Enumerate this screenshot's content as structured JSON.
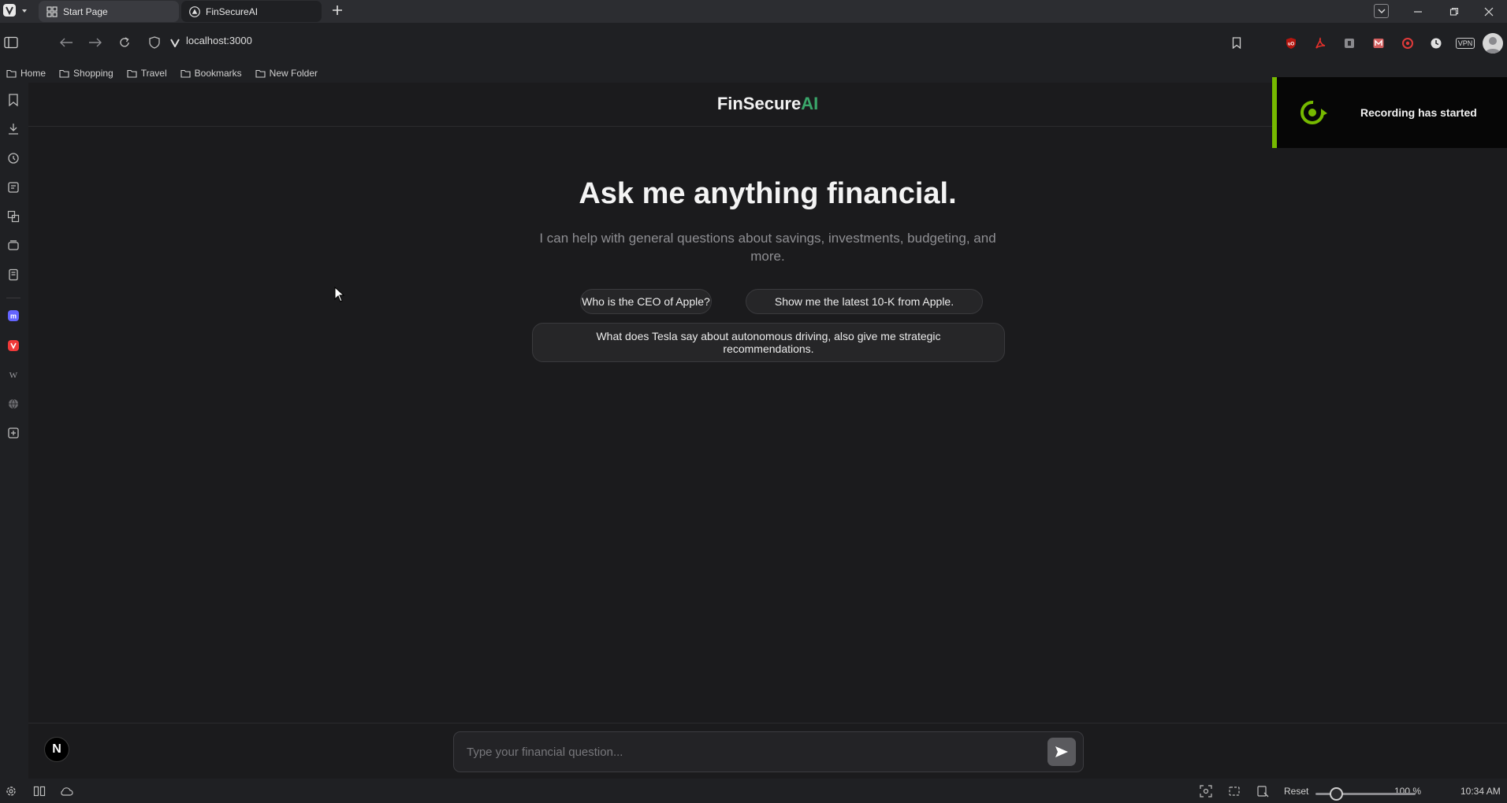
{
  "browser": {
    "tabs": [
      {
        "label": "Start Page"
      },
      {
        "label": "FinSecureAI"
      }
    ],
    "url": "localhost:3000",
    "bookmarks": [
      "Home",
      "Shopping",
      "Travel",
      "Bookmarks",
      "New Folder"
    ],
    "extensions": [
      "uBlock",
      "PDF",
      "Ext",
      "Mail",
      "Ext2",
      "Clock",
      "VPN"
    ],
    "vpn_label": "VPN",
    "status": {
      "reset_label": "Reset",
      "zoom": "100 %",
      "time": "10:34 AM",
      "zoom_level": 0.17
    }
  },
  "app": {
    "brand_main": "FinSecure",
    "brand_accent": "AI",
    "hero_title": "Ask me anything financial.",
    "hero_subtitle": "I can help with general questions about savings, investments, budgeting, and more.",
    "suggestions": [
      "Who is the CEO of Apple?",
      "Show me the latest 10-K from Apple.",
      "What does Tesla say about autonomous driving, also give me strategic recommendations."
    ],
    "input": {
      "placeholder": "Type your financial question...",
      "value": ""
    },
    "avatar_letter": "N"
  },
  "toast": {
    "message": "Recording has started"
  },
  "colors": {
    "accent_green": "#3aa66a",
    "toast_accent": "#76b900",
    "background": "#1b1b1d"
  }
}
